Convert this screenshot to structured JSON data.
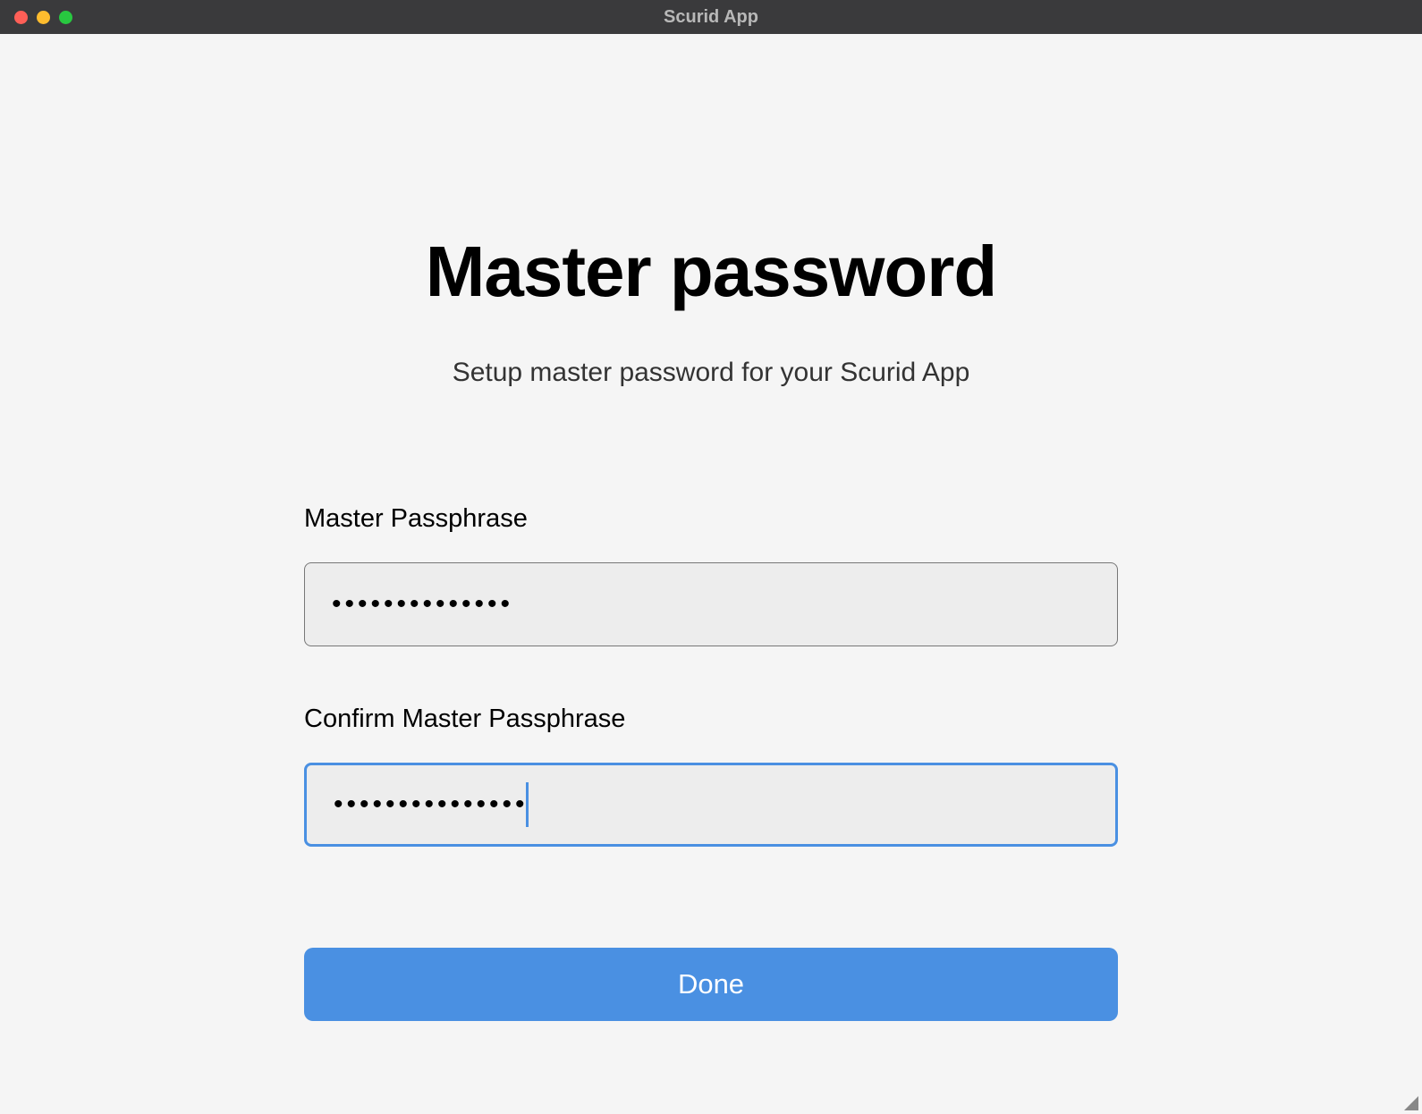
{
  "window": {
    "title": "Scurid App"
  },
  "page": {
    "title": "Master password",
    "subtitle": "Setup master password for your Scurid App"
  },
  "form": {
    "passphrase": {
      "label": "Master Passphrase",
      "value": "••••••••••••••"
    },
    "confirm_passphrase": {
      "label": "Confirm Master Passphrase",
      "value": "•••••••••••••••"
    },
    "done_label": "Done"
  }
}
